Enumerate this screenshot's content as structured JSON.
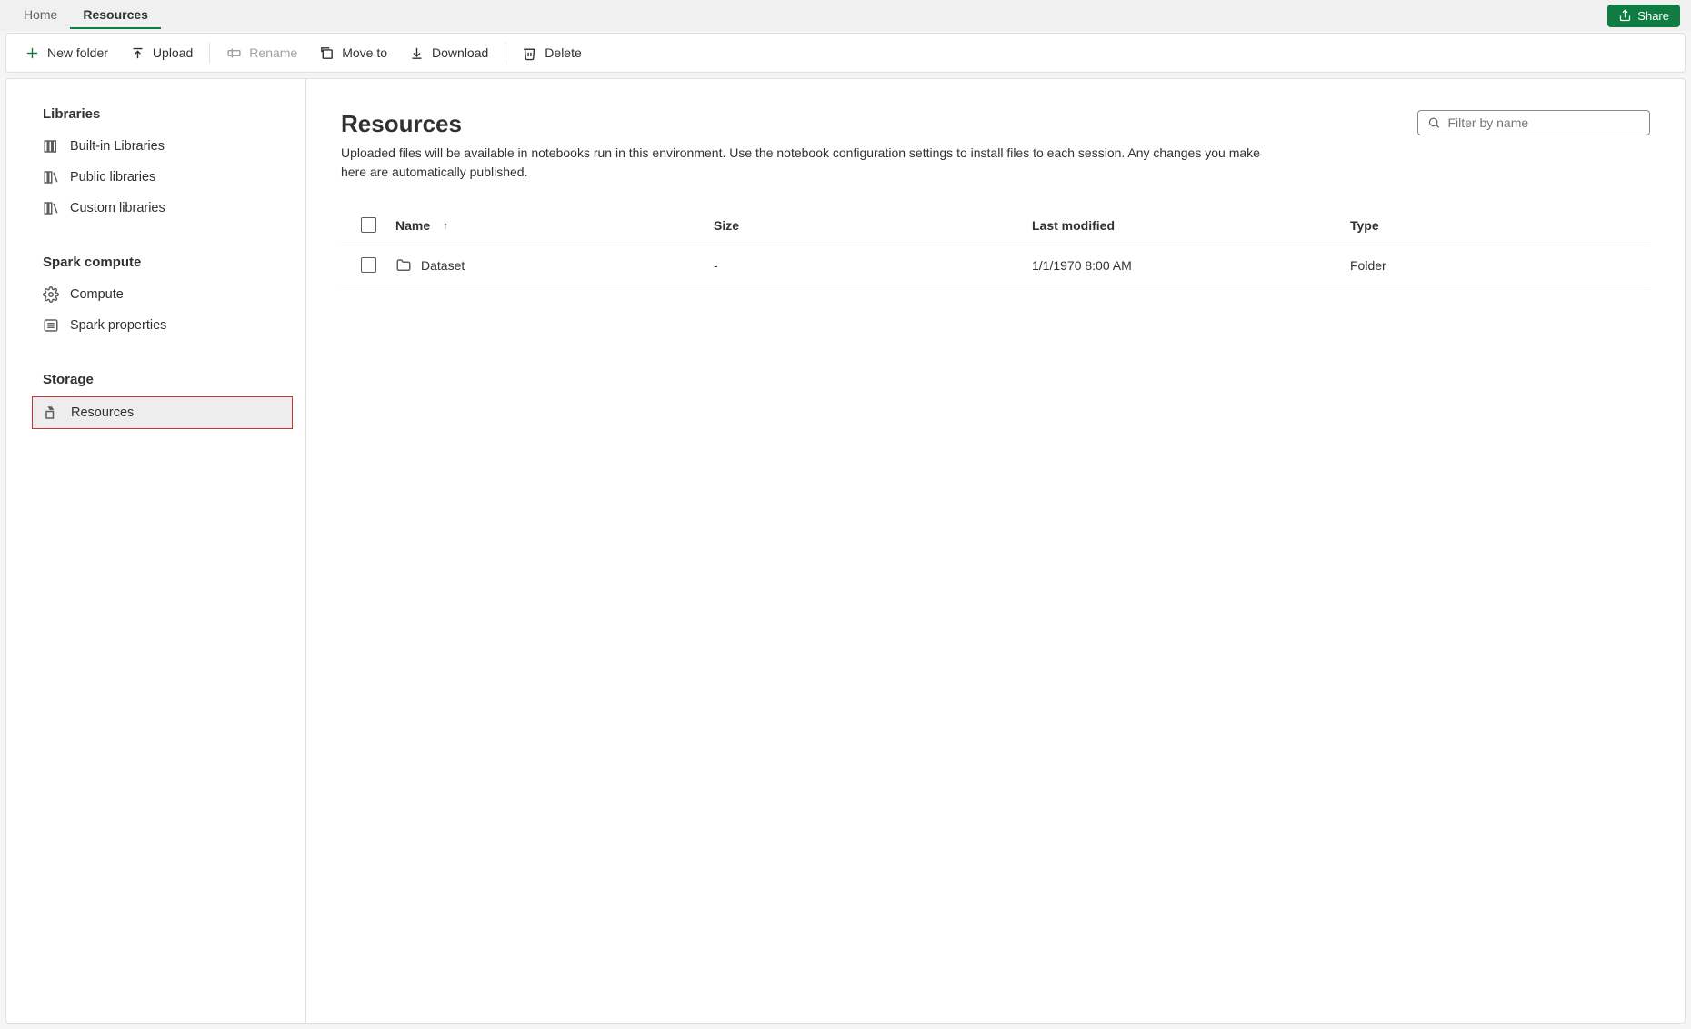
{
  "tabs": {
    "home": "Home",
    "resources": "Resources"
  },
  "share_label": "Share",
  "toolbar": {
    "new_folder": "New folder",
    "upload": "Upload",
    "rename": "Rename",
    "move_to": "Move to",
    "download": "Download",
    "delete": "Delete"
  },
  "sidebar": {
    "libraries_title": "Libraries",
    "builtin": "Built-in Libraries",
    "public": "Public libraries",
    "custom": "Custom libraries",
    "spark_title": "Spark compute",
    "compute": "Compute",
    "spark_props": "Spark properties",
    "storage_title": "Storage",
    "resources": "Resources"
  },
  "page": {
    "title": "Resources",
    "desc": "Uploaded files will be available in notebooks run in this environment. Use the notebook configuration settings to install files to each session. Any changes you make here are automatically published.",
    "filter_placeholder": "Filter by name"
  },
  "table": {
    "col_name": "Name",
    "col_size": "Size",
    "col_modified": "Last modified",
    "col_type": "Type",
    "rows": [
      {
        "name": "Dataset",
        "size": "-",
        "modified": "1/1/1970 8:00 AM",
        "type": "Folder"
      }
    ]
  }
}
